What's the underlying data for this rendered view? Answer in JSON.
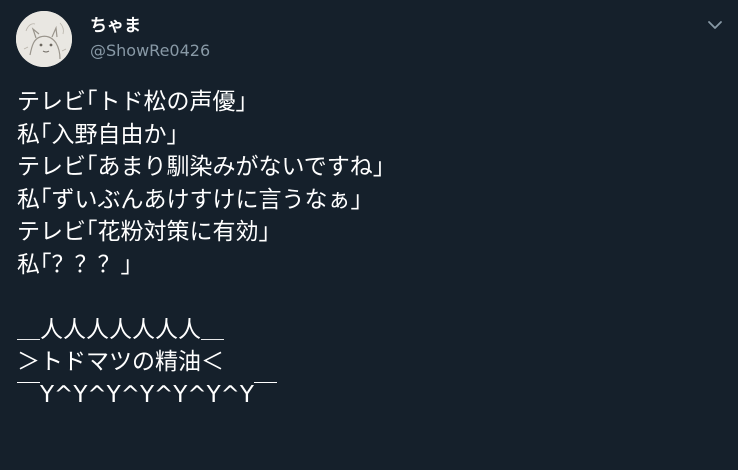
{
  "author": {
    "display_name": "ちゃま",
    "handle": "@ShowRe0426",
    "avatar_icon": "avatar-drawing",
    "menu_icon": "chevron-down-icon"
  },
  "tweet": {
    "lines": [
      "テレビ｢トド松の声優｣",
      "私｢入野自由か｣",
      "テレビ｢あまり馴染みがないですね｣",
      "私｢ずいぶんあけすけに言うなぁ｣",
      "テレビ｢花粉対策に有効｣",
      "私｢？？？｣",
      "",
      "＿人人人人人人人＿",
      "＞トドマツの精油＜",
      "￣Y^Y^Y^Y^Y^Y^Y￣"
    ]
  },
  "colors": {
    "background": "#15202b",
    "text_primary": "#ffffff",
    "text_secondary": "#8899a6"
  }
}
